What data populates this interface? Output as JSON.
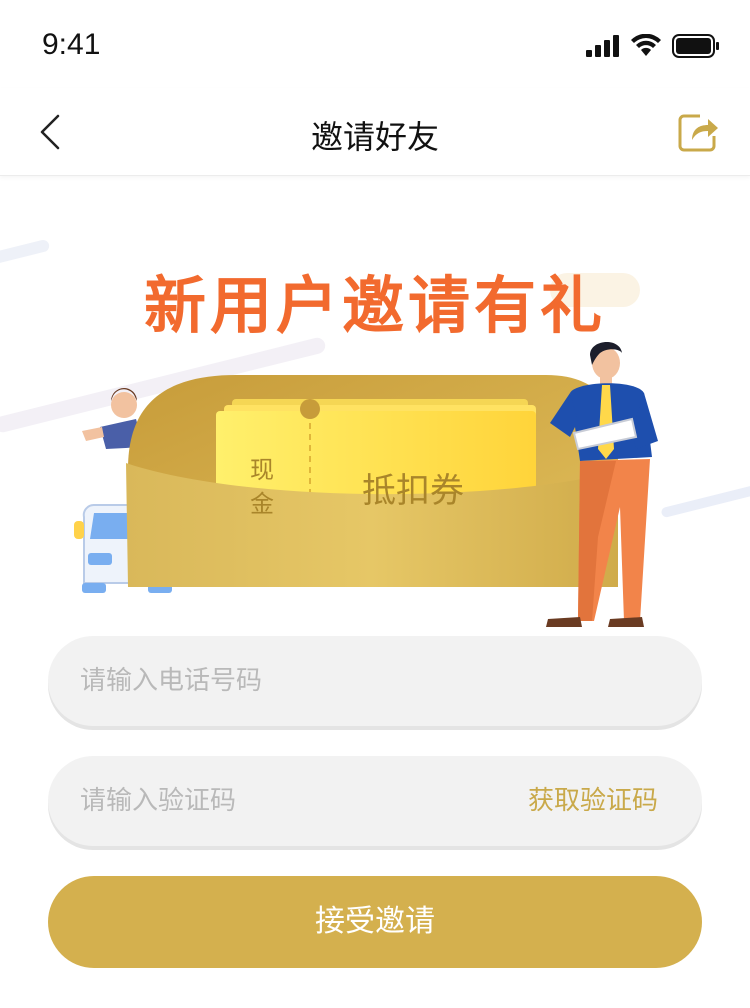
{
  "status_bar": {
    "time": "9:41"
  },
  "nav": {
    "title": "邀请好友",
    "back_icon": "chevron-left-icon",
    "share_icon": "share-icon"
  },
  "hero": {
    "title": "新用户邀请有礼",
    "coupon_left_line1": "现",
    "coupon_left_line2": "金",
    "coupon_right": "抵扣券"
  },
  "form": {
    "phone_placeholder": "请输入电话号码",
    "code_placeholder": "请输入验证码",
    "get_code_label": "获取验证码",
    "accept_label": "接受邀请"
  },
  "colors": {
    "accent_gold": "#d4b04e",
    "title_orange": "#f26a2e",
    "coupon_yellow": "#ffd84a"
  }
}
